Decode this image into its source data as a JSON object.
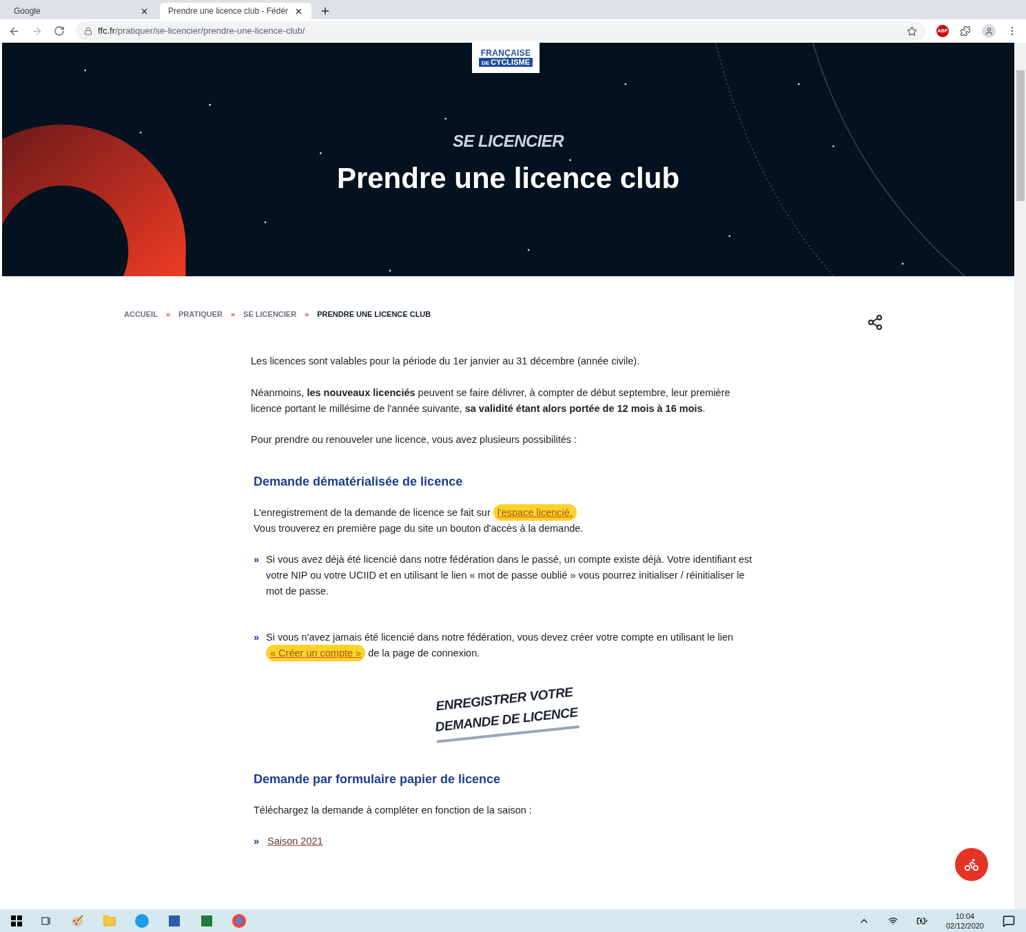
{
  "browser": {
    "tabs": [
      {
        "title": "Google",
        "selected": false
      },
      {
        "title": "Prendre une licence club - Fédér",
        "selected": true
      }
    ],
    "url_host": "ffc.fr",
    "url_path": "/pratiquer/se-licencier/prendre-une-licence-club/",
    "adblock_badge": "ABP"
  },
  "logo": {
    "line1": "FRANÇAISE",
    "prefix": "DE",
    "line2": "CYCLISME"
  },
  "hero": {
    "kicker": "SE LICENCIER",
    "title": "Prendre une licence club"
  },
  "breadcrumb": [
    {
      "label": "ACCUEIL",
      "current": false
    },
    {
      "label": "PRATIQUER",
      "current": false
    },
    {
      "label": "SE LICENCIER",
      "current": false
    },
    {
      "label": "PRENDRE UNE LICENCE CLUB",
      "current": true
    }
  ],
  "breadcrumb_separator": "»",
  "intro": [
    "Les licences sont valables pour la période du 1er janvier au 31 décembre (année civile).",
    "Néanmoins, **les nouveaux licenciés** peuvent se faire délivrer, à compter de début septembre, leur première licence portant le millésime de l'année suivante, **sa validité étant alors portée de 12 mois à 16 mois**.",
    "Pour prendre ou renouveler une licence, vous avez plusieurs possibilités :"
  ],
  "section1": {
    "heading": "Demande dématérialisée de licence",
    "line1_before": "L'enregistrement de la demande de licence se fait sur ",
    "line1_link": "l'espace licencié.",
    "line2": "Vous trouverez en première page du site un bouton d'accès à la demande.",
    "bullets": [
      {
        "text": "Si vous avez déjà été licencié dans notre fédération dans le passé, un compte existe déjà. Votre identifiant est votre NIP ou votre UCIID et en utilisant le lien « mot de passe oublié » vous pourrez initialiser / réinitialiser le mot de passe."
      },
      {
        "before": "Si vous n'avez jamais été licencié dans notre fédération, vous devez créer votre compte en utilisant le lien ",
        "link": "« Créer un compte »",
        "after": " de la page de connexion."
      }
    ],
    "cta_line1": "ENREGISTRER VOTRE",
    "cta_line2": "DEMANDE DE LICENCE"
  },
  "section2": {
    "heading": "Demande par formulaire papier de licence",
    "text": "Téléchargez la demande à compléter en fonction de la saison :",
    "links": [
      "Saison 2021"
    ]
  },
  "bullet_mark": "»",
  "taskbar": {
    "time": "10:04",
    "date": "02/12/2020"
  }
}
